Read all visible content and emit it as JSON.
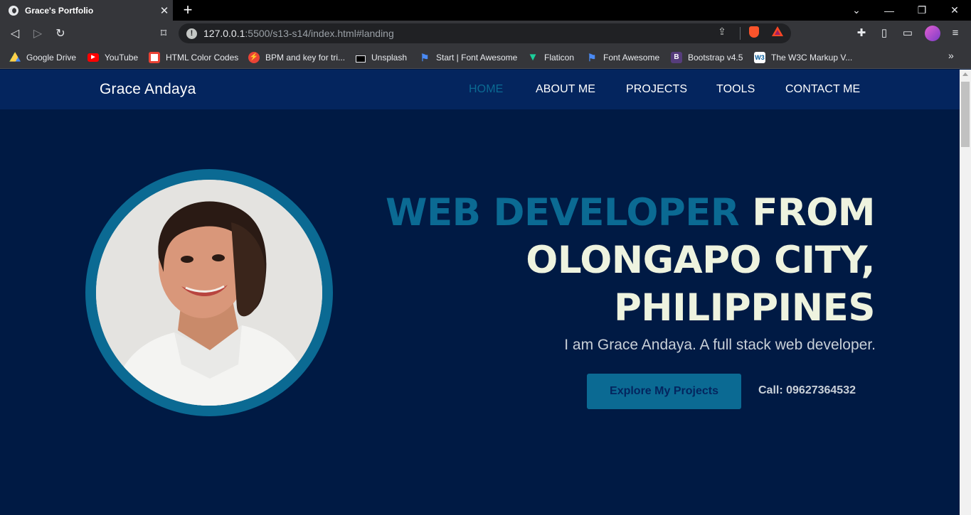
{
  "browser": {
    "tab_title": "Grace's Portfolio",
    "tab_close": "✕",
    "new_tab": "+",
    "url_host": "127.0.0.1",
    "url_path": ":5500/s13-s14/index.html#landing",
    "bookmarks": [
      {
        "label": "Google Drive",
        "icon": "google-drive-icon",
        "color": "#1fa463"
      },
      {
        "label": "YouTube",
        "icon": "youtube-icon",
        "color": "#ff0000"
      },
      {
        "label": "HTML Color Codes",
        "icon": "html-color-codes-icon",
        "color": "#e8eaed"
      },
      {
        "label": "BPM and key for tri...",
        "icon": "bpm-icon",
        "color": "#ea4335"
      },
      {
        "label": "Unsplash",
        "icon": "unsplash-icon",
        "color": "#000000"
      },
      {
        "label": "Start | Font Awesome",
        "icon": "flag-icon",
        "color": "#4a8af4"
      },
      {
        "label": "Flaticon",
        "icon": "flaticon-icon",
        "color": "#1bcf9b"
      },
      {
        "label": "Font Awesome",
        "icon": "flag-icon",
        "color": "#4a8af4"
      },
      {
        "label": "Bootstrap v4.5",
        "icon": "bootstrap-icon",
        "color": "#563d7c"
      },
      {
        "label": "The W3C Markup V...",
        "icon": "w3c-icon",
        "color": "#ffffff"
      }
    ]
  },
  "site": {
    "brand": "Grace Andaya",
    "nav": [
      "HOME",
      "ABOUT ME",
      "PROJECTS",
      "TOOLS",
      "CONTACT ME"
    ],
    "active_nav": "HOME",
    "headline_accent": "WEB DEVELOPER",
    "headline_rest": "FROM OLONGAPO CITY, PHILIPPINES",
    "subline": "I am Grace Andaya. A full stack web developer.",
    "cta_label": "Explore My Projects",
    "call_text": "Call: 09627364532",
    "colors": {
      "accent": "#0b6a93",
      "background": "#001a44",
      "nav_background": "#04255e",
      "headline": "#eef3df"
    }
  }
}
